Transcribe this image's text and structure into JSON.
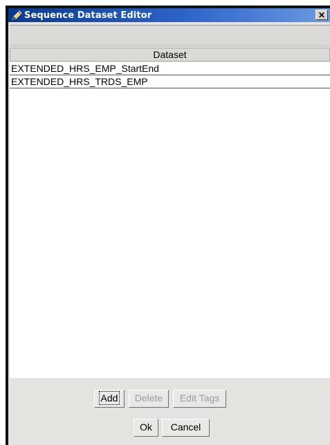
{
  "window": {
    "title": "Sequence Dataset Editor",
    "close_glyph": "✕"
  },
  "table": {
    "header": "Dataset",
    "rows": [
      "EXTENDED_HRS_EMP_StartEnd",
      "EXTENDED_HRS_TRDS_EMP"
    ]
  },
  "buttons": {
    "add": "Add",
    "delete": "Delete",
    "edit_tags": "Edit Tags",
    "ok": "Ok",
    "cancel": "Cancel"
  }
}
